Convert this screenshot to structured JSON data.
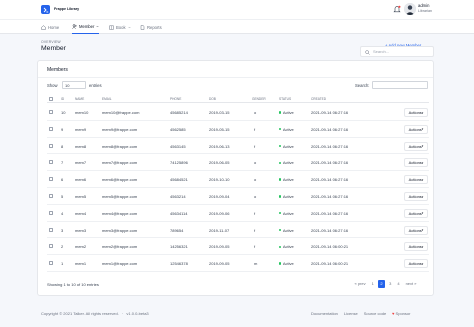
{
  "app": {
    "logo_text": "Frappe Library"
  },
  "user": {
    "name": "admin",
    "role": "Librarian"
  },
  "nav": [
    {
      "label": "Home",
      "icon": "home-icon"
    },
    {
      "label": "Member",
      "icon": "users-icon",
      "active": true
    },
    {
      "label": "Book",
      "icon": "book-icon",
      "has_dropdown": true
    },
    {
      "label": "Reports",
      "icon": "document-icon"
    }
  ],
  "page": {
    "overview": "OVERVIEW",
    "title": "Member",
    "search_placeholder": "Search...",
    "add_button": "+ Add new Member"
  },
  "table": {
    "title": "Members",
    "show_label": "Show",
    "entries_value": "10",
    "entries_label": "entries",
    "search_label": "Search:",
    "columns": [
      "ID",
      "NAME",
      "EMAIL",
      "PHONE",
      "DOB",
      "GENDER",
      "STATUS",
      "CREATED"
    ],
    "rows": [
      {
        "id": "10",
        "name": "mem10",
        "email": "mem10@frappe.com",
        "phone": "45685214",
        "dob": "2019-03-15",
        "gender": "o",
        "status": "Active",
        "created": "2021-09-14 06:27:16"
      },
      {
        "id": "9",
        "name": "mem9",
        "email": "mem9@frappe.com",
        "phone": "4562585",
        "dob": "2019-05-15",
        "gender": "f",
        "status": "Active",
        "created": "2021-09-14 06:27:16"
      },
      {
        "id": "8",
        "name": "mem8",
        "email": "mem8@frappe.com",
        "phone": "4563145",
        "dob": "2019-06-13",
        "gender": "f",
        "status": "Active",
        "created": "2021-09-14 06:27:16"
      },
      {
        "id": "7",
        "name": "mem7",
        "email": "mem7@frappe.com",
        "phone": "74125896",
        "dob": "2019-06-05",
        "gender": "o",
        "status": "Active",
        "created": "2021-09-14 06:27:16"
      },
      {
        "id": "6",
        "name": "mem6",
        "email": "mem6@frappe.com",
        "phone": "45684521",
        "dob": "2019-10-10",
        "gender": "o",
        "status": "Active",
        "created": "2021-09-14 06:27:16"
      },
      {
        "id": "5",
        "name": "mem5",
        "email": "mem5@frappe.com",
        "phone": "4563214",
        "dob": "2019-09-04",
        "gender": "o",
        "status": "Active",
        "created": "2021-09-14 06:27:16"
      },
      {
        "id": "4",
        "name": "mem4",
        "email": "mem4@frappe.com",
        "phone": "45634114",
        "dob": "2019-09-06",
        "gender": "f",
        "status": "Active",
        "created": "2021-09-14 06:27:16"
      },
      {
        "id": "3",
        "name": "mem3",
        "email": "mem3@frappe.com",
        "phone": "789654",
        "dob": "2019-11-07",
        "gender": "f",
        "status": "Active",
        "created": "2021-09-14 06:27:16"
      },
      {
        "id": "2",
        "name": "mem2",
        "email": "mem2@frappe.com",
        "phone": "14256321",
        "dob": "2019-09-05",
        "gender": "f",
        "status": "Active",
        "created": "2021-09-14 06:00:21"
      },
      {
        "id": "1",
        "name": "mem1",
        "email": "mem1@frappe.com",
        "phone": "12546378",
        "dob": "2019-09-05",
        "gender": "m",
        "status": "Active",
        "created": "2021-09-14 06:00:21"
      }
    ],
    "actions_label": "Actions",
    "showing_text": "Showing 1 to 10 of 10 entries"
  },
  "pagination": {
    "prev": "« prev",
    "pages": [
      "1",
      "2",
      "3",
      "4"
    ],
    "current": "2",
    "next": "next »"
  },
  "footer": {
    "copyright": "Copyright © 2021 Talker. All rights reserved.",
    "version": "v1.0.0-beta3",
    "links": [
      "Documentation",
      "License",
      "Source code",
      "Sponsor"
    ]
  },
  "colors": {
    "accent": "#2563eb",
    "active_dot": "#22c55e"
  }
}
